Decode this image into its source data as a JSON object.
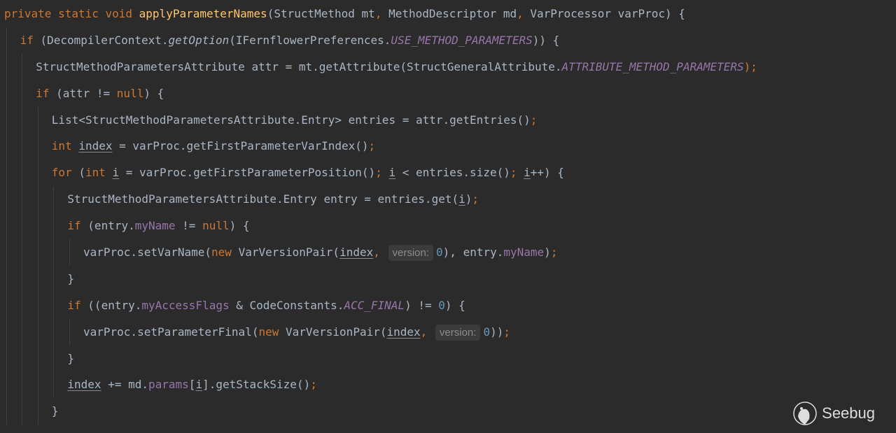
{
  "editor": {
    "lines": [
      {
        "indent": 0,
        "tokens": [
          [
            "private static void ",
            "kw"
          ],
          [
            "applyParameterNames",
            "fn"
          ],
          [
            "(StructMethod mt",
            ""
          ],
          [
            ", ",
            "kw"
          ],
          [
            "MethodDescriptor md",
            ""
          ],
          [
            ", ",
            "kw"
          ],
          [
            "VarProcessor varProc) {",
            ""
          ]
        ]
      },
      {
        "indent": 1,
        "tokens": [
          [
            "if ",
            "kw"
          ],
          [
            "(DecompilerContext.",
            ""
          ],
          [
            "getOption",
            "smth"
          ],
          [
            "(IFernflowerPreferences.",
            ""
          ],
          [
            "USE_METHOD_PARAMETERS",
            "sfld"
          ],
          [
            ")) {",
            ""
          ]
        ]
      },
      {
        "indent": 2,
        "tokens": [
          [
            "StructMethodParametersAttribute attr = mt.getAttribute(StructGeneralAttribute.",
            ""
          ],
          [
            "ATTRIBUTE_METHOD_PARAMETERS",
            "sfld"
          ],
          [
            ");",
            "kw"
          ]
        ]
      },
      {
        "indent": 2,
        "tokens": [
          [
            "if ",
            "kw"
          ],
          [
            "(attr != ",
            ""
          ],
          [
            "null",
            "kw"
          ],
          [
            ") {",
            ""
          ]
        ]
      },
      {
        "indent": 3,
        "tokens": [
          [
            "List<StructMethodParametersAttribute.Entry> entries = attr.getEntries()",
            ""
          ],
          [
            ";",
            "kw"
          ]
        ]
      },
      {
        "indent": 3,
        "tokens": [
          [
            "int ",
            "kw"
          ],
          [
            "index",
            "var"
          ],
          [
            " = varProc.getFirstParameterVarIndex()",
            ""
          ],
          [
            ";",
            "kw"
          ]
        ]
      },
      {
        "indent": 3,
        "tokens": [
          [
            "for ",
            "kw"
          ],
          [
            "(",
            ""
          ],
          [
            "int ",
            "kw"
          ],
          [
            "i",
            "var"
          ],
          [
            " = varProc.getFirstParameterPosition()",
            ""
          ],
          [
            "; ",
            "kw"
          ],
          [
            "i",
            "var"
          ],
          [
            " < entries.size()",
            ""
          ],
          [
            "; ",
            "kw"
          ],
          [
            "i",
            "var"
          ],
          [
            "++) {",
            ""
          ]
        ]
      },
      {
        "indent": 4,
        "tokens": [
          [
            "StructMethodParametersAttribute.Entry entry = entries.get(",
            ""
          ],
          [
            "i",
            "var"
          ],
          [
            ")",
            ""
          ],
          [
            ";",
            "kw"
          ]
        ]
      },
      {
        "indent": 4,
        "tokens": [
          [
            "if ",
            "kw"
          ],
          [
            "(entry.",
            ""
          ],
          [
            "myName",
            "fld"
          ],
          [
            " != ",
            ""
          ],
          [
            "null",
            "kw"
          ],
          [
            ") {",
            ""
          ]
        ]
      },
      {
        "indent": 5,
        "tokens": [
          [
            "varProc.setVarName(",
            ""
          ],
          [
            "new ",
            "kw"
          ],
          [
            "VarVersionPair(",
            ""
          ],
          [
            "index",
            "var"
          ],
          [
            ", ",
            "kw"
          ],
          [
            "version:",
            "hint"
          ],
          [
            "0",
            "num"
          ],
          [
            "), entry.",
            ""
          ],
          [
            "myName",
            "fld"
          ],
          [
            ")",
            ""
          ],
          [
            ";",
            "kw"
          ]
        ]
      },
      {
        "indent": 4,
        "tokens": [
          [
            "}",
            ""
          ]
        ]
      },
      {
        "indent": 4,
        "tokens": [
          [
            "if ",
            "kw"
          ],
          [
            "((entry.",
            ""
          ],
          [
            "myAccessFlags",
            "fld"
          ],
          [
            " & CodeConstants.",
            ""
          ],
          [
            "ACC_FINAL",
            "sfld"
          ],
          [
            ") != ",
            ""
          ],
          [
            "0",
            "num"
          ],
          [
            ") {",
            ""
          ]
        ]
      },
      {
        "indent": 5,
        "tokens": [
          [
            "varProc.setParameterFinal(",
            ""
          ],
          [
            "new ",
            "kw"
          ],
          [
            "VarVersionPair(",
            ""
          ],
          [
            "index",
            "var"
          ],
          [
            ", ",
            "kw"
          ],
          [
            "version:",
            "hint"
          ],
          [
            "0",
            "num"
          ],
          [
            "))",
            ""
          ],
          [
            ";",
            "kw"
          ]
        ]
      },
      {
        "indent": 4,
        "tokens": [
          [
            "}",
            ""
          ]
        ]
      },
      {
        "indent": 4,
        "tokens": [
          [
            "index",
            "var"
          ],
          [
            " += md.",
            ""
          ],
          [
            "params",
            "fld"
          ],
          [
            "[",
            ""
          ],
          [
            "i",
            "var"
          ],
          [
            "].getStackSize()",
            ""
          ],
          [
            ";",
            "kw"
          ]
        ]
      },
      {
        "indent": 3,
        "tokens": [
          [
            "}",
            ""
          ]
        ]
      }
    ]
  },
  "watermark": {
    "text": "Seebug"
  }
}
